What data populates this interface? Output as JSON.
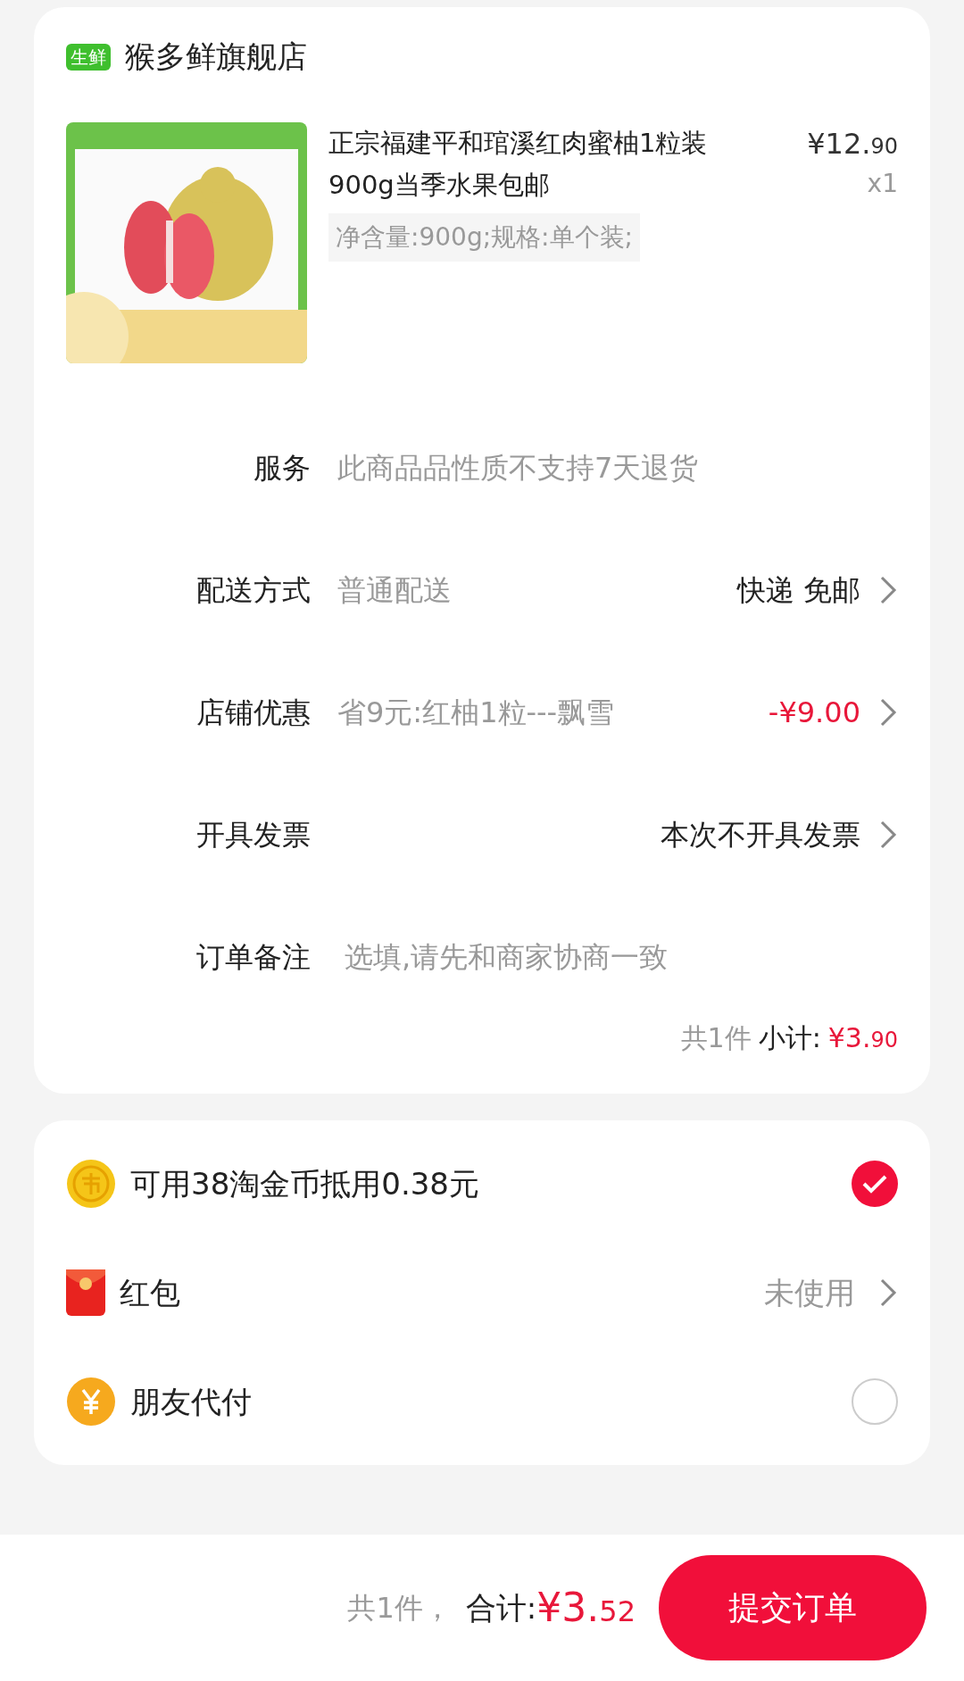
{
  "store": {
    "badge": "生鲜",
    "name": "猴多鲜旗舰店"
  },
  "item": {
    "kind": "picture",
    "title": "正宗福建平和琯溪红肉蜜柚1粒装900g当季水果包邮",
    "currency": "¥",
    "price_int": "12.",
    "price_frac": "90",
    "quantity": "x1",
    "spec": "净含量:900g;规格:单个装;"
  },
  "rows": [
    {
      "kind": "text",
      "label": "服务",
      "value": "此商品品性质不支持7天退货"
    },
    {
      "kind": "link",
      "label": "配送方式",
      "value": "普通配送",
      "option": "快递 免邮"
    },
    {
      "kind": "discount",
      "label": "店铺优惠",
      "value": "省9元:红柚1粒---飘雪",
      "option": "-¥9.00"
    },
    {
      "kind": "link",
      "label": "开具发票",
      "option": "本次不开具发票"
    },
    {
      "kind": "field",
      "label": "订单备注",
      "placeholder": "选填,请先和商家协商一致"
    }
  ],
  "subtotal": {
    "count": "共1件",
    "label": "小计:",
    "currency": "¥",
    "int": "3.",
    "frac": "90"
  },
  "options": [
    {
      "kind": "check",
      "label": "可用38淘金币抵用0.38元",
      "checked": true
    },
    {
      "kind": "link",
      "label": "红包",
      "value": "未使用"
    },
    {
      "kind": "check",
      "label": "朋友代付",
      "checked": false
    }
  ],
  "footer": {
    "count": "共1件，",
    "label": "合计:",
    "currency": "¥",
    "int": "3.",
    "frac": "52",
    "submit": "提交订单"
  }
}
